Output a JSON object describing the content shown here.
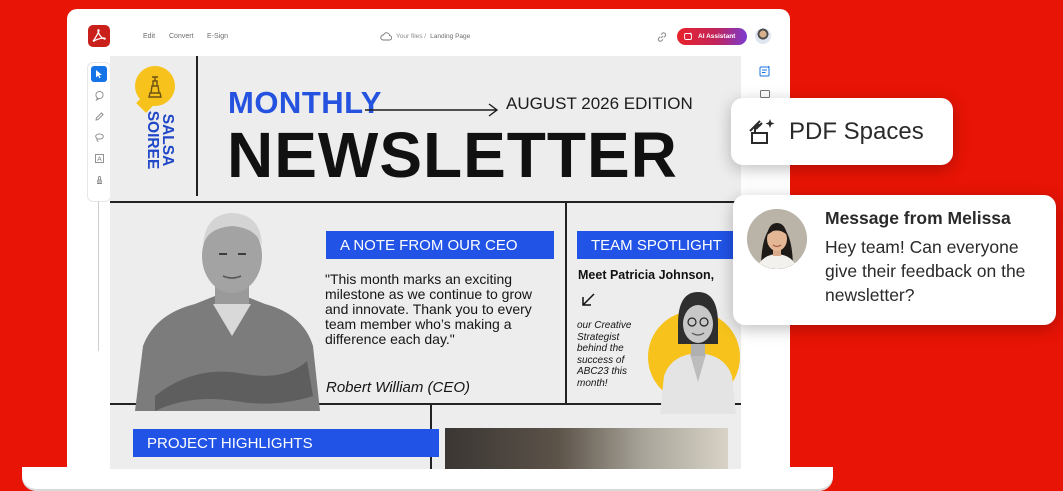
{
  "app": {
    "menu": [
      "Edit",
      "Convert",
      "E-Sign"
    ],
    "breadcrumb": {
      "parent": "Your files /",
      "current": "Landing Page"
    },
    "ai_button_label": "AI Assistant",
    "brand_color": "#c9201c"
  },
  "newsletter": {
    "brand_line1": "SALSA",
    "brand_line2": "SOIREE",
    "title_top": "MONTHLY",
    "edition": "AUGUST 2026 EDITION",
    "title_main": "NEWSLETTER",
    "ceo_heading": "A NOTE FROM OUR CEO",
    "ceo_quote": "\"This month marks an exciting milestone as we continue to grow and innovate. Thank you to every team member who’s making a difference each day.\"",
    "ceo_signature": "Robert William (CEO)",
    "spotlight_heading": "TEAM SPOTLIGHT",
    "spotlight_name": "Meet Patricia Johnson,",
    "spotlight_text": "our Creative Strategist behind the success of ABC23 this month!",
    "projects_heading": "PROJECT HIGHLIGHTS",
    "accent_blue": "#2153e6",
    "accent_yellow": "#f6c21b"
  },
  "spaces_card": {
    "label": "PDF Spaces"
  },
  "message_card": {
    "title": "Message from Melissa",
    "body": "Hey team! Can everyone give their feedback on the newsletter?"
  },
  "background_color": "#e81405"
}
